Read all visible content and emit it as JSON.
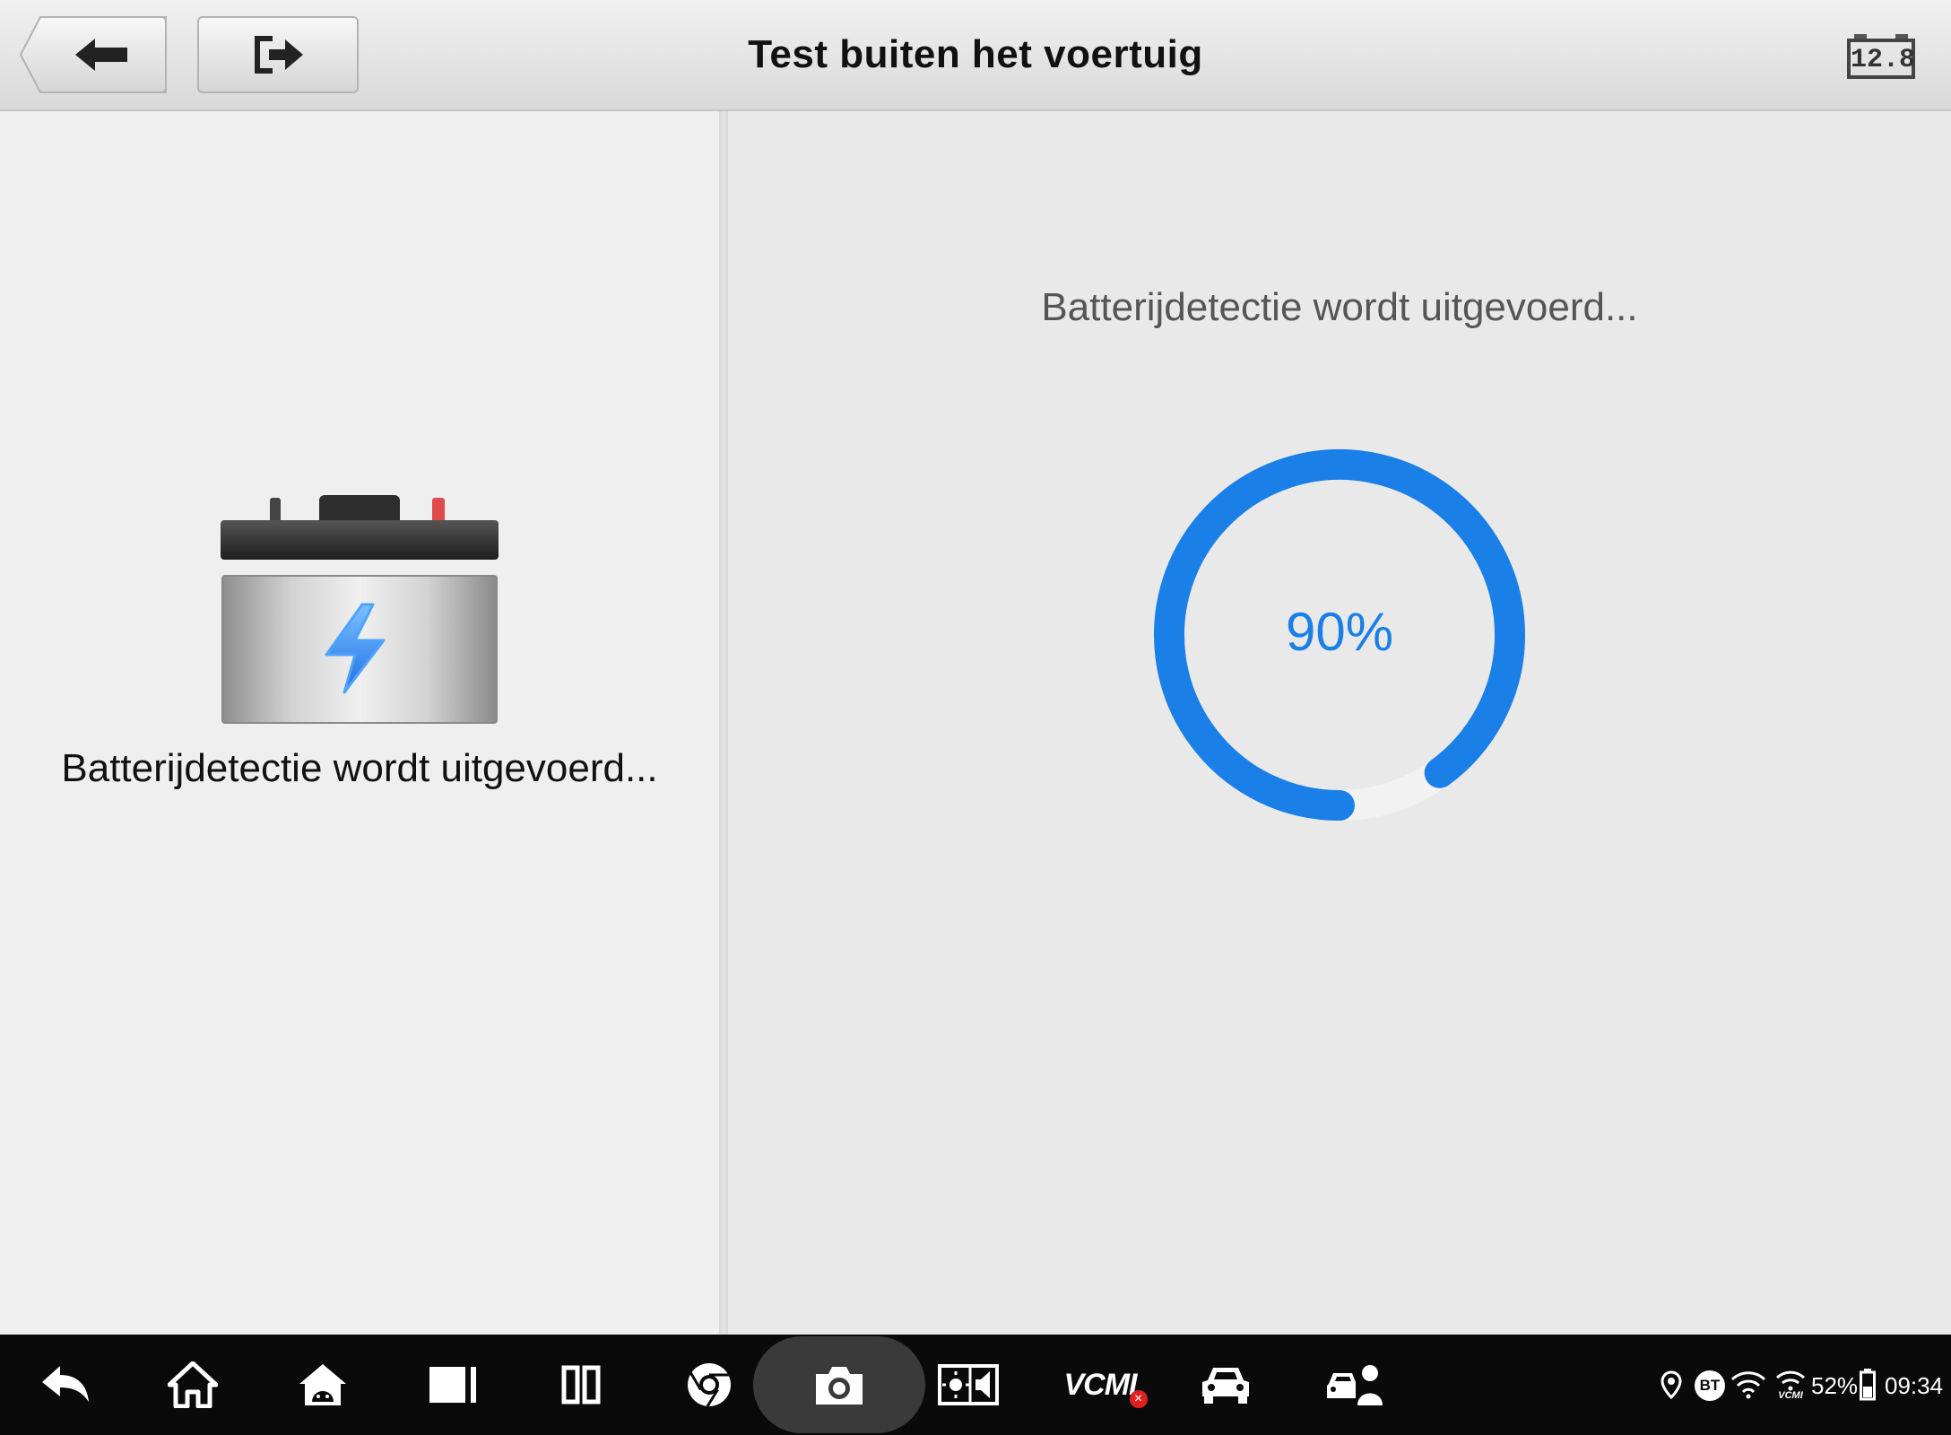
{
  "header": {
    "title": "Test buiten het voertuig",
    "back_button_icon": "back-arrow-icon",
    "exit_button_icon": "exit-icon",
    "voltage": "12.8"
  },
  "left_panel": {
    "illustration_icon": "car-battery-icon",
    "status_text": "Batterijdetectie wordt uitgevoerd..."
  },
  "right_panel": {
    "status_text": "Batterijdetectie wordt uitgevoerd...",
    "progress": {
      "value": 90,
      "label": "90%"
    },
    "accent_color": "#1a7fe6"
  },
  "navbar": {
    "items": [
      {
        "icon": "back-icon"
      },
      {
        "icon": "home-icon"
      },
      {
        "icon": "android-home-icon"
      },
      {
        "icon": "recent-apps-icon"
      },
      {
        "icon": "split-screen-icon"
      },
      {
        "icon": "chrome-icon"
      },
      {
        "icon": "camera-icon"
      },
      {
        "icon": "brightness-volume-icon"
      },
      {
        "icon": "vcmi-icon",
        "label": "VCMI"
      },
      {
        "icon": "car-icon"
      },
      {
        "icon": "car-service-icon"
      }
    ],
    "status": {
      "battery_percent": "52%",
      "time": "09:34",
      "bt_label": "BT",
      "vcmi_label": "VCMI"
    }
  }
}
